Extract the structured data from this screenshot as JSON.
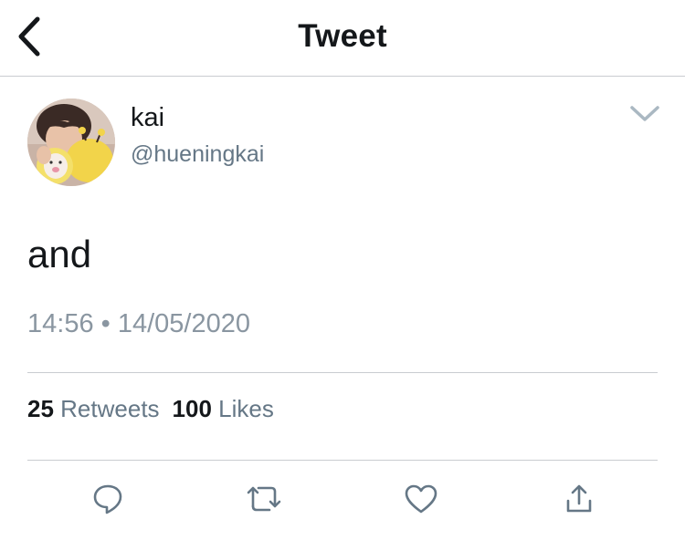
{
  "header": {
    "title": "Tweet",
    "back_icon": "chevron-left-icon"
  },
  "author": {
    "name": "kai",
    "handle": "@hueningkai",
    "avatar": "avatar-photo"
  },
  "tweet": {
    "text": "and",
    "time": "14:56",
    "separator": "•",
    "date": "14/05/2020"
  },
  "stats": {
    "retweets_count": "25",
    "retweets_label": "Retweets",
    "likes_count": "100",
    "likes_label": "Likes"
  },
  "actions": {
    "reply_icon": "reply-icon",
    "retweet_icon": "retweet-icon",
    "like_icon": "heart-icon",
    "share_icon": "share-icon"
  },
  "colors": {
    "text_primary": "#14171a",
    "text_secondary": "#657786",
    "accent": "#1da1f2",
    "divider": "#c9ccd1"
  }
}
